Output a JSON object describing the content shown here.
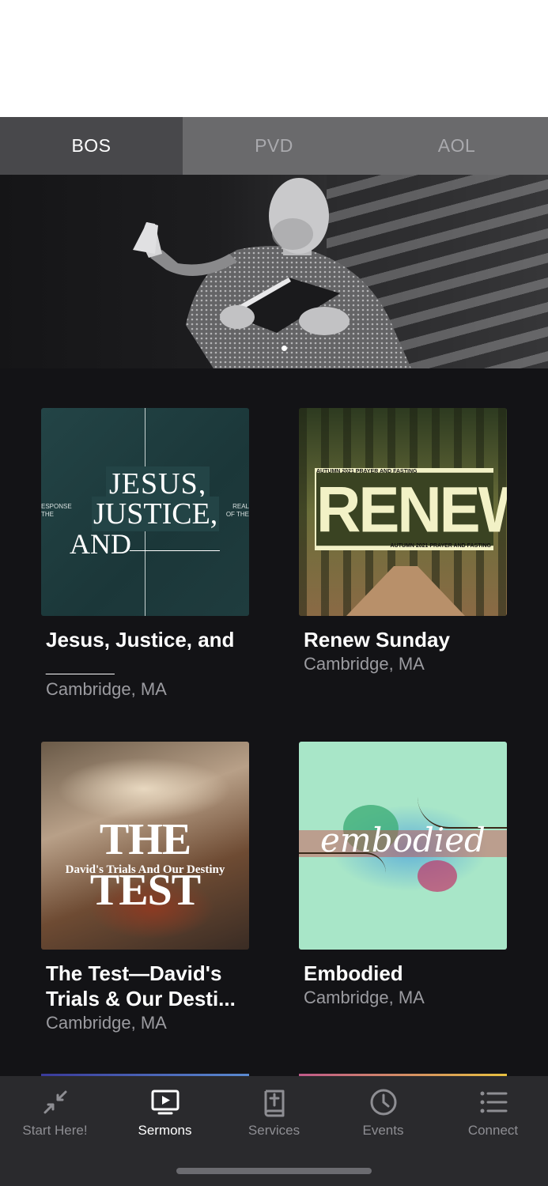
{
  "location_tabs": [
    {
      "label": "BOS",
      "active": true
    },
    {
      "label": "PVD",
      "active": false
    },
    {
      "label": "AOL",
      "active": false
    }
  ],
  "hero": {
    "image": "pastor-preaching-photo",
    "page_indicator": "1 of 1"
  },
  "sermon_series": [
    {
      "title": "Jesus, Justice, and ______",
      "location": "Cambridge, MA",
      "art": {
        "line1": "JESUS,",
        "line2": "JUSTICE,",
        "line3": "AND",
        "left_text": "ESPONSE THE",
        "right_text": "REAL OF THE"
      }
    },
    {
      "title": "Renew Sunday",
      "location": "Cambridge, MA",
      "art": {
        "big": "RENEW",
        "banner_top": "AUTUMN 2021 PRAYER AND FASTING",
        "banner_bottom": "AUTUMN 2021 PRAYER AND FASTING"
      }
    },
    {
      "title": "The Test—David's Trials & Our Desti...",
      "location": "Cambridge, MA",
      "art": {
        "big": "THE TEST",
        "sub": "David's Trials And Our Destiny"
      }
    },
    {
      "title": "Embodied",
      "location": "Cambridge, MA",
      "art": {
        "script": "embodied"
      }
    }
  ],
  "tabbar": [
    {
      "label": "Start Here!",
      "icon": "arrows-in-icon",
      "active": false
    },
    {
      "label": "Sermons",
      "icon": "tv-play-icon",
      "active": true
    },
    {
      "label": "Services",
      "icon": "bible-icon",
      "active": false
    },
    {
      "label": "Events",
      "icon": "clock-icon",
      "active": false
    },
    {
      "label": "Connect",
      "icon": "list-icon",
      "active": false
    }
  ],
  "colors": {
    "background": "#131316",
    "tabbar": "#2a2a2d",
    "active_tab": "#48484b",
    "inactive_tab": "#6a6a6c"
  }
}
